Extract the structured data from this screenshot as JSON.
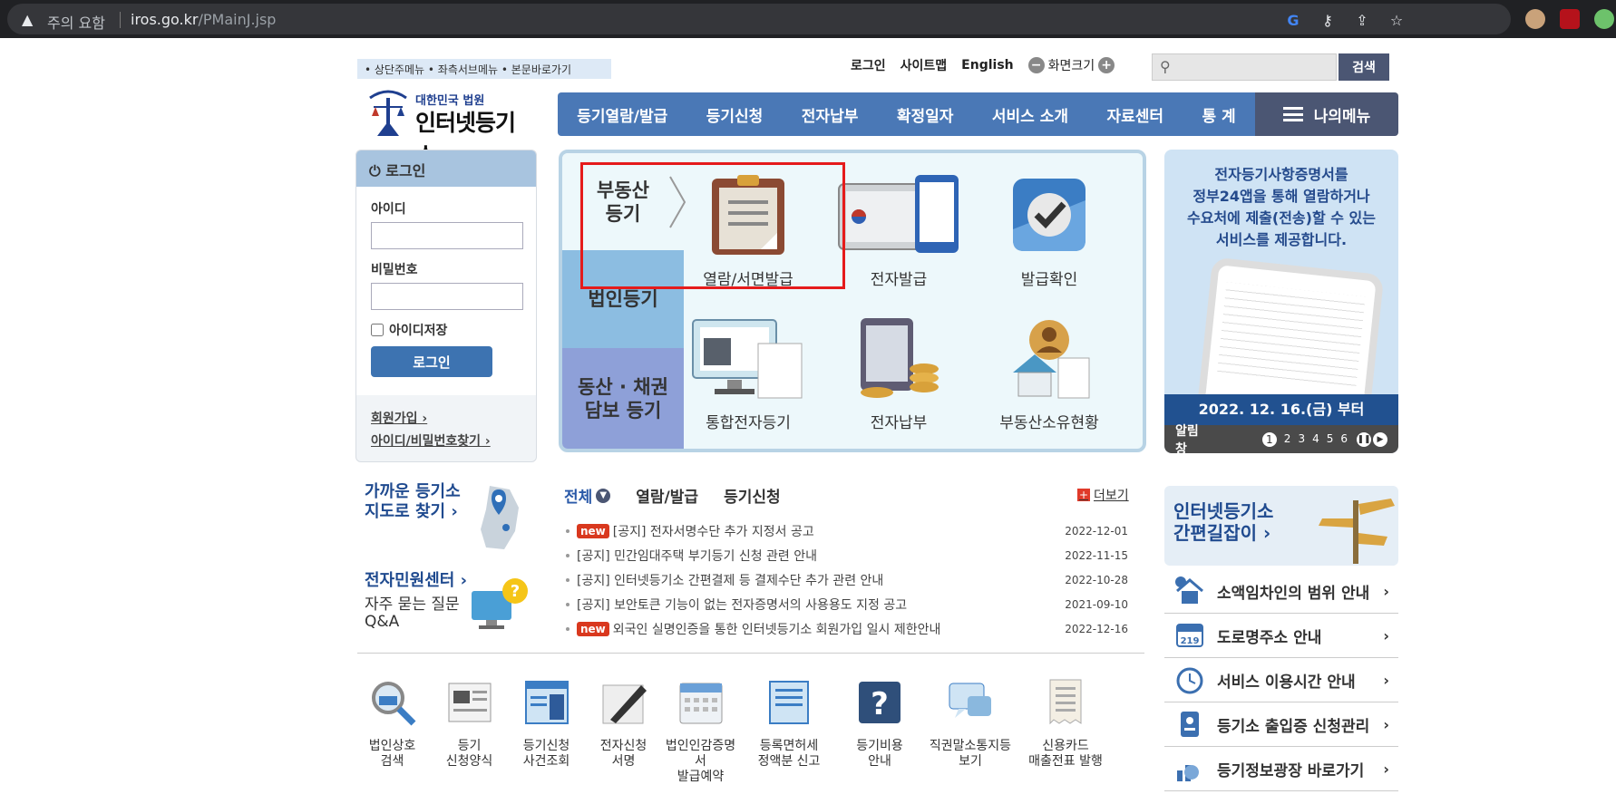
{
  "browser": {
    "warning": "주의 요함",
    "url_host": "iros.go.kr",
    "url_path": "/PMainJ.jsp"
  },
  "util": {
    "skip_links": "• 상단주메뉴 • 좌측서브메뉴 • 본문바로가기",
    "login": "로그인",
    "sitemap": "사이트맵",
    "english": "English",
    "font_size": "화면크기",
    "search_button": "검색",
    "search_placeholder": ""
  },
  "logo": {
    "sub": "대한민국 법원",
    "main": "인터넷등기소"
  },
  "gnb": [
    "등기열람/발급",
    "등기신청",
    "전자납부",
    "확정일자",
    "서비스 소개",
    "자료센터",
    "통 계"
  ],
  "my_menu": "나의메뉴",
  "login_panel": {
    "title": "로그인",
    "id_label": "아이디",
    "pw_label": "비밀번호",
    "save_id": "아이디저장",
    "button": "로그인",
    "join": "회원가입",
    "find": "아이디/비밀번호찾기"
  },
  "categories": {
    "real_estate": "부동산\n등기",
    "corp": "법인등기",
    "movable": "동산 · 채권\n담보 등기"
  },
  "services": [
    {
      "label": "열람/서면발급",
      "icon": "clipboard-icon"
    },
    {
      "label": "전자발급",
      "icon": "e-issue-icon"
    },
    {
      "label": "발급확인",
      "icon": "checkmark-icon"
    },
    {
      "label": "통합전자등기",
      "icon": "monitor-document-icon"
    },
    {
      "label": "전자납부",
      "icon": "tablet-coins-icon"
    },
    {
      "label": "부동산소유현황",
      "icon": "house-person-icon"
    }
  ],
  "banner": {
    "text": "전자등기사항증명서를\n정부24앱을 통해 열람하거나\n수요처에 제출(전송)할 수 있는\n서비스를 제공합니다.",
    "date": "2022. 12. 16.(금) 부터",
    "alarm": "알림창",
    "pages": [
      "1",
      "2",
      "3",
      "4",
      "5",
      "6"
    ]
  },
  "nearby": {
    "line1": "가까운 등기소",
    "line2": "지도로 찾기 ›"
  },
  "epc": {
    "title": "전자민원센터 ›",
    "sub1": "자주 묻는 질문",
    "sub2": "Q&A"
  },
  "notice_tabs": {
    "all": "전체",
    "view": "열람/발급",
    "apply": "등기신청",
    "more": "더보기"
  },
  "notices": [
    {
      "new": true,
      "title": "[공지] 전자서명수단 추가 지정서 공고",
      "date": "2022-12-01"
    },
    {
      "new": false,
      "title": "[공지] 민간임대주택 부기등기 신청 관련 안내",
      "date": "2022-11-15"
    },
    {
      "new": false,
      "title": "[공지] 인터넷등기소 간편결제 등 결제수단 추가 관련 안내",
      "date": "2022-10-28"
    },
    {
      "new": false,
      "title": "[공지] 보안토큰 기능이 없는 전자증명서의 사용용도 지정 공고",
      "date": "2021-09-10"
    },
    {
      "new": true,
      "title": "외국인 실명인증을 통한 인터넷등기소 회원가입 일시 제한안내",
      "date": "2022-12-16"
    }
  ],
  "new_badge": "new",
  "quick": [
    {
      "l1": "법인상호",
      "l2": "검색"
    },
    {
      "l1": "등기",
      "l2": "신청양식"
    },
    {
      "l1": "등기신청",
      "l2": "사건조회"
    },
    {
      "l1": "전자신청",
      "l2": "서명"
    },
    {
      "l1": "법인인감증명서",
      "l2": "발급예약"
    },
    {
      "l1": "등록면허세",
      "l2": "정액분 신고"
    },
    {
      "l1": "등기비용",
      "l2": "안내"
    },
    {
      "l1": "직권말소통지등",
      "l2": "보기"
    },
    {
      "l1": "신용카드",
      "l2": "매출전표 발행"
    }
  ],
  "guide": {
    "line1": "인터넷등기소",
    "line2": "간편길잡이 ›"
  },
  "right_list": [
    "소액임차인의 범위 안내",
    "도로명주소 안내",
    "서비스 이용시간 안내",
    "등기소 출입증 신청관리",
    "등기정보광장 바로가기"
  ]
}
